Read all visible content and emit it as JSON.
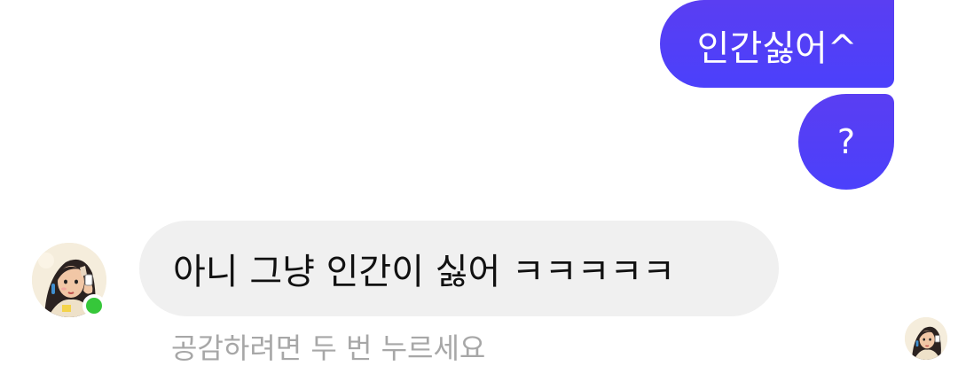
{
  "conversation": {
    "sent_messages": [
      {
        "text": "인간싫어^"
      },
      {
        "text": "?"
      }
    ],
    "received_message": {
      "text": "아니 그냥 인간이 싫어 ㅋㅋㅋㅋㅋ"
    },
    "reaction_hint": "공감하려면 두 번 누르세요"
  },
  "colors": {
    "sent_bubble": "#4b40fb",
    "received_bubble": "#f0f0f0",
    "online_status": "#36c73a",
    "hint_text": "#a7a7a7"
  },
  "icons": {
    "contact_avatar": "contact-avatar-icon",
    "read_receipt": "read-receipt-avatar-icon"
  }
}
